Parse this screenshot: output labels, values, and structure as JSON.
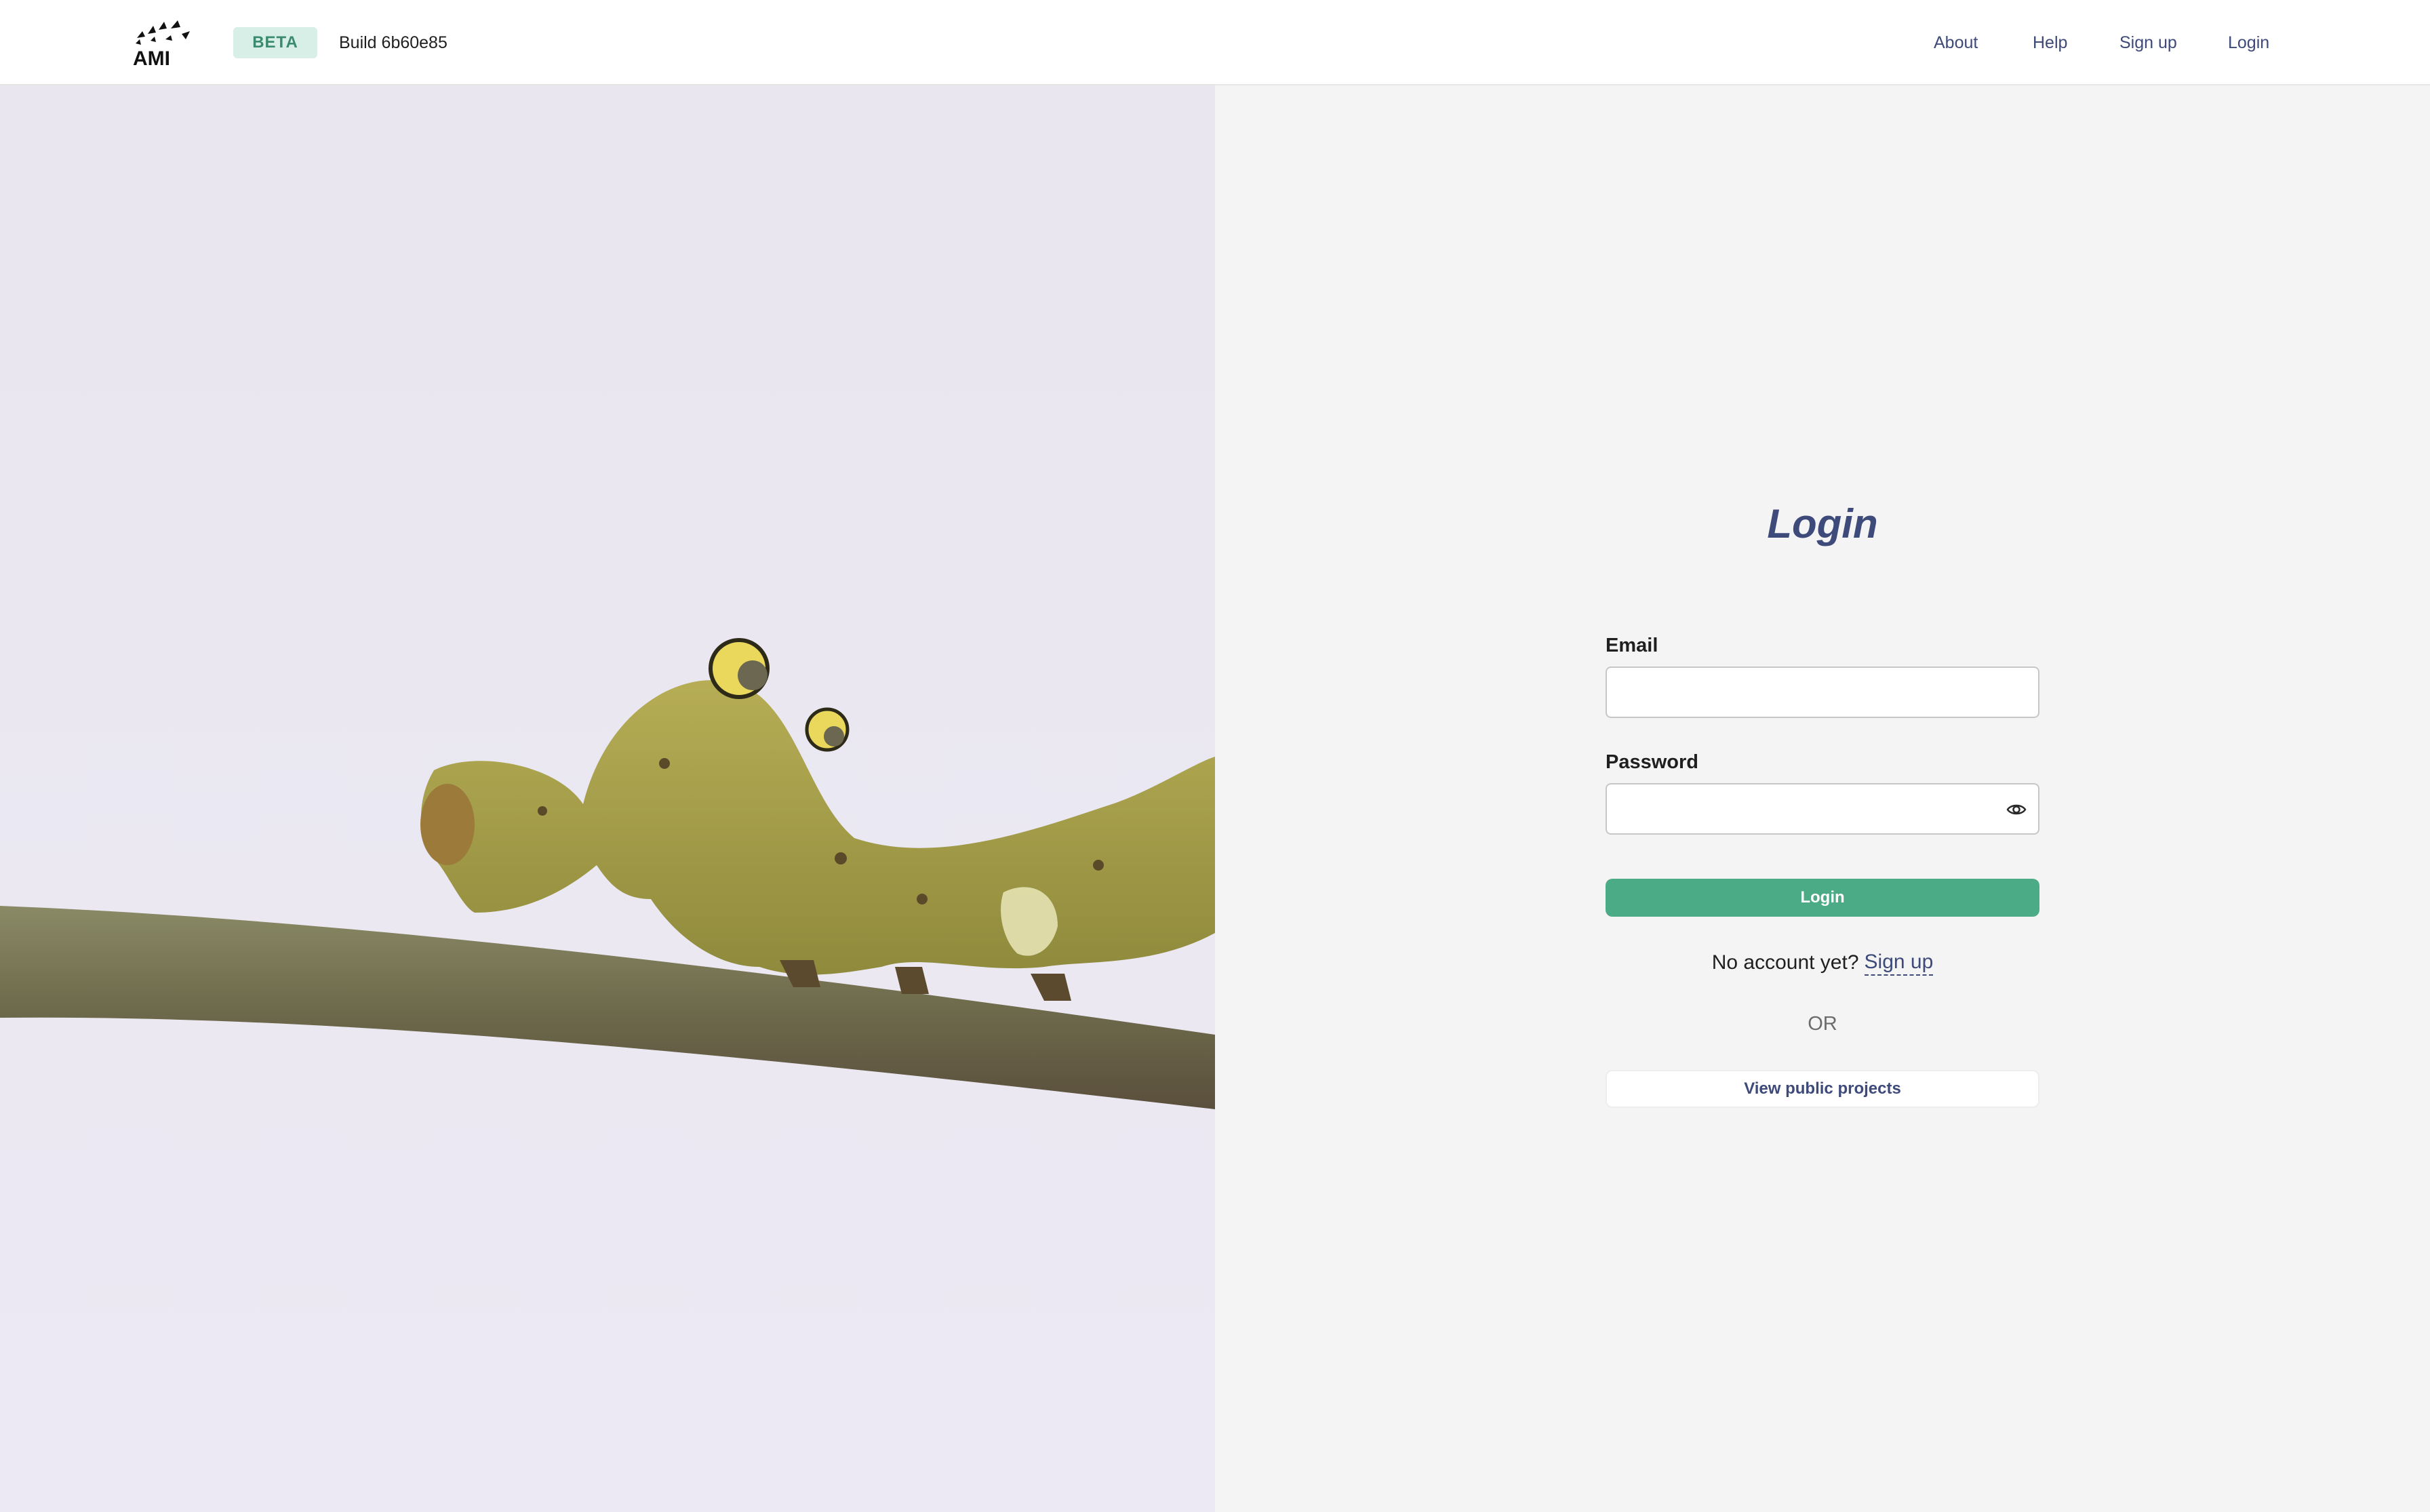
{
  "header": {
    "logo_text": "AMI",
    "badge": "BETA",
    "build": "Build 6b60e85",
    "nav": {
      "about": "About",
      "help": "Help",
      "signup": "Sign up",
      "login": "Login"
    }
  },
  "login": {
    "title": "Login",
    "email_label": "Email",
    "email_value": "",
    "password_label": "Password",
    "password_value": "",
    "password_toggle_icon": "eye-icon",
    "submit_label": "Login",
    "no_account_text": "No account yet?",
    "signup_link": "Sign up",
    "or_text": "OR",
    "public_projects_label": "View public projects"
  },
  "colors": {
    "accent": "#4cab87",
    "link": "#3d4a7a",
    "badge_bg": "#d8efe7",
    "panel_bg": "#f4f4f4"
  }
}
